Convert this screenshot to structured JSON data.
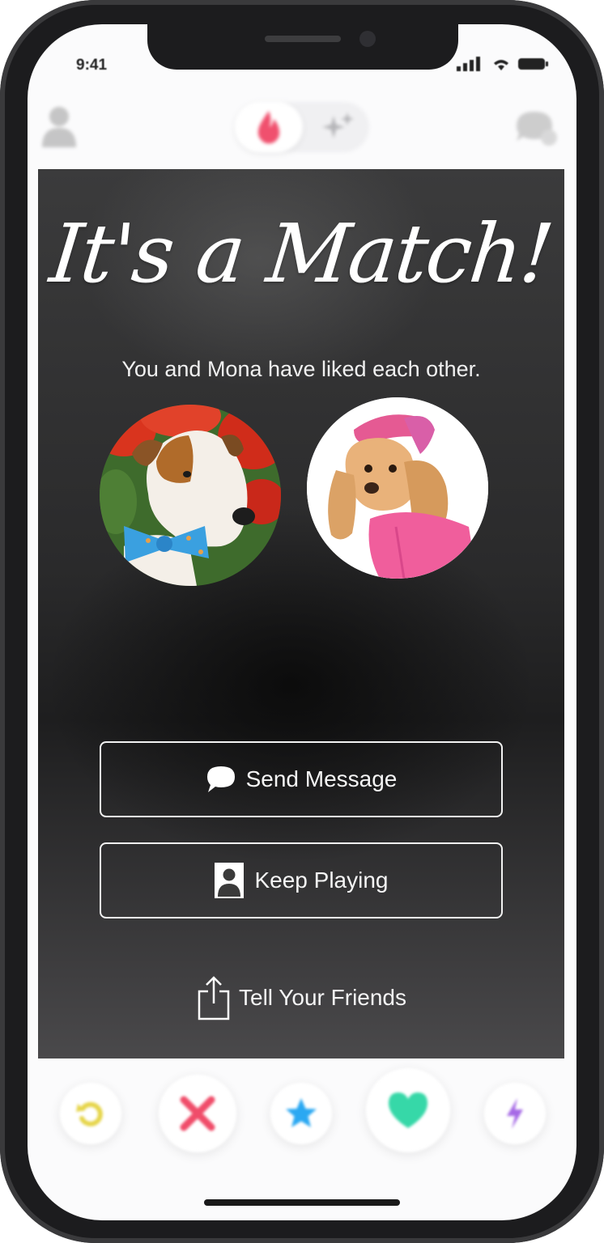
{
  "status_bar": {
    "time": "9:41"
  },
  "top_nav": {
    "profile_icon": "person-icon",
    "center_tabs": [
      "flame-icon",
      "sparkle-icon"
    ],
    "messages_icon": "chat-bubbles-icon"
  },
  "match": {
    "title": "It's a Match!",
    "subtitle": "You and Mona have liked each other.",
    "send_message_label": "Send Message",
    "keep_playing_label": "Keep Playing",
    "tell_friends_label": "Tell Your Friends"
  },
  "actions": [
    {
      "name": "rewind",
      "icon": "rewind-icon",
      "color": "#e6d54a"
    },
    {
      "name": "nope",
      "icon": "x-icon",
      "color": "#f04d6a"
    },
    {
      "name": "super-like",
      "icon": "star-icon",
      "color": "#2aa8f2"
    },
    {
      "name": "like",
      "icon": "heart-icon",
      "color": "#36d8a8"
    },
    {
      "name": "boost",
      "icon": "lightning-icon",
      "color": "#a66ae6"
    }
  ],
  "colors": {
    "brand_flame": "#f0506e",
    "overlay": "#2c2c2d",
    "button_border": "#f2f2f2"
  }
}
